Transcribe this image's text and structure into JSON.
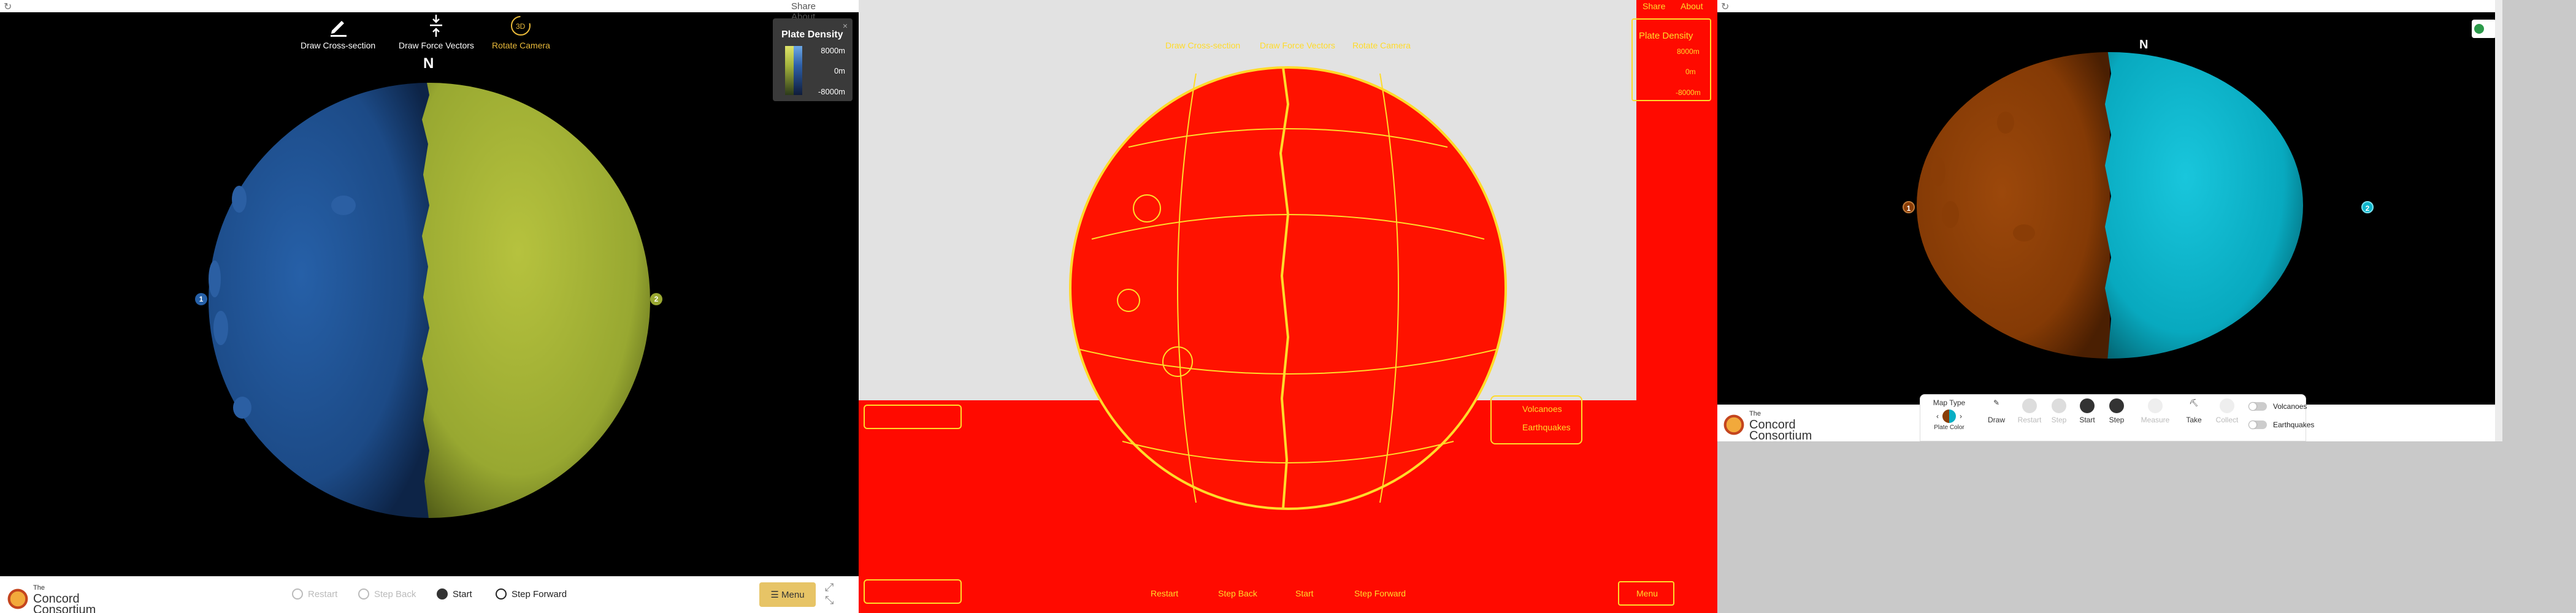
{
  "panel1": {
    "top_links": [
      "Share",
      "About"
    ],
    "tools": [
      {
        "label": "Draw Cross-section",
        "icon": "pencil-icon"
      },
      {
        "label": "Draw Force Vectors",
        "icon": "force-vector-icon"
      },
      {
        "label": "Rotate Camera",
        "icon": "rotate-3d-icon",
        "badge": "3D"
      }
    ],
    "compass": "N",
    "legend": {
      "title": "Plate Density",
      "values": [
        "8000m",
        "0m",
        "-8000m"
      ],
      "close": "×"
    },
    "markers": [
      "1",
      "2"
    ],
    "logo": {
      "line1": "The",
      "line2": "Concord",
      "line3": "Consortium"
    },
    "controls": [
      {
        "label": "Restart",
        "enabled": false
      },
      {
        "label": "Step Back",
        "enabled": false
      },
      {
        "label": "Start",
        "enabled": true
      },
      {
        "label": "Step Forward",
        "enabled": true
      }
    ],
    "menu_label": "Menu",
    "colors": {
      "plate1": "#1e4d8a",
      "plate2": "#9aa832",
      "accent": "#e7c466"
    }
  },
  "panel2": {
    "top_links": [
      "Share",
      "About"
    ],
    "tools": [
      "Draw Cross-section",
      "Draw Force Vectors",
      "Rotate Camera"
    ],
    "legend_title": "Plate Density",
    "legend_values": [
      "8000m",
      "0m",
      "-8000m"
    ],
    "toggles": [
      "Volcanoes",
      "Earthquakes"
    ],
    "controls": [
      "Restart",
      "Step Back",
      "Start",
      "Step Forward"
    ],
    "menu_label": "Menu",
    "colors": {
      "background": "#ff0a00",
      "edge": "#ffdb2a"
    }
  },
  "panel3": {
    "compass": "N",
    "markers": [
      "1",
      "2"
    ],
    "logo": {
      "line1": "The",
      "line2": "Concord",
      "line3": "Consortium"
    },
    "map_type": {
      "title": "Map Type",
      "value": "Plate Color"
    },
    "dock": [
      {
        "label": "Draw",
        "enabled": true
      },
      {
        "label": "Restart",
        "enabled": false
      },
      {
        "label": "Step",
        "enabled": false
      },
      {
        "label": "Start",
        "enabled": true
      },
      {
        "label": "Step",
        "enabled": true
      },
      {
        "label": "Measure",
        "enabled": false
      },
      {
        "label": "Take",
        "enabled": true
      },
      {
        "label": "Collect",
        "enabled": false
      }
    ],
    "toggles": [
      "Volcanoes",
      "Earthquakes"
    ],
    "colors": {
      "plate1": "#8a3d06",
      "plate2": "#09aec4"
    }
  }
}
